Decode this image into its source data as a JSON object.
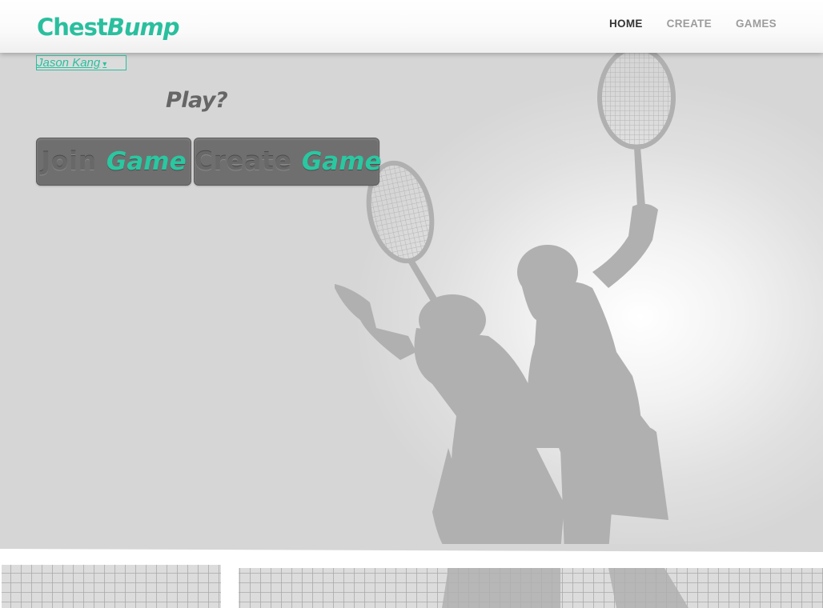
{
  "header": {
    "logo_part1": "Chest",
    "logo_part2": "Bump",
    "nav": [
      "HOME",
      "CREATE",
      "GAMES"
    ],
    "active_nav": "HOME"
  },
  "user_menu": {
    "name": "Jason Kang",
    "caret": "▾"
  },
  "play": {
    "title": "Play?",
    "join_button": {
      "word1": "Join",
      "word2": "Game"
    },
    "create_button": {
      "word1": "Create",
      "word2": "Game"
    }
  },
  "colors": {
    "accent": "#2abf9e",
    "button_bg": "#6f6f6f",
    "silhouette": "#b0b0b0",
    "nav_active": "#333333",
    "nav_inactive": "#9c9c9c"
  }
}
